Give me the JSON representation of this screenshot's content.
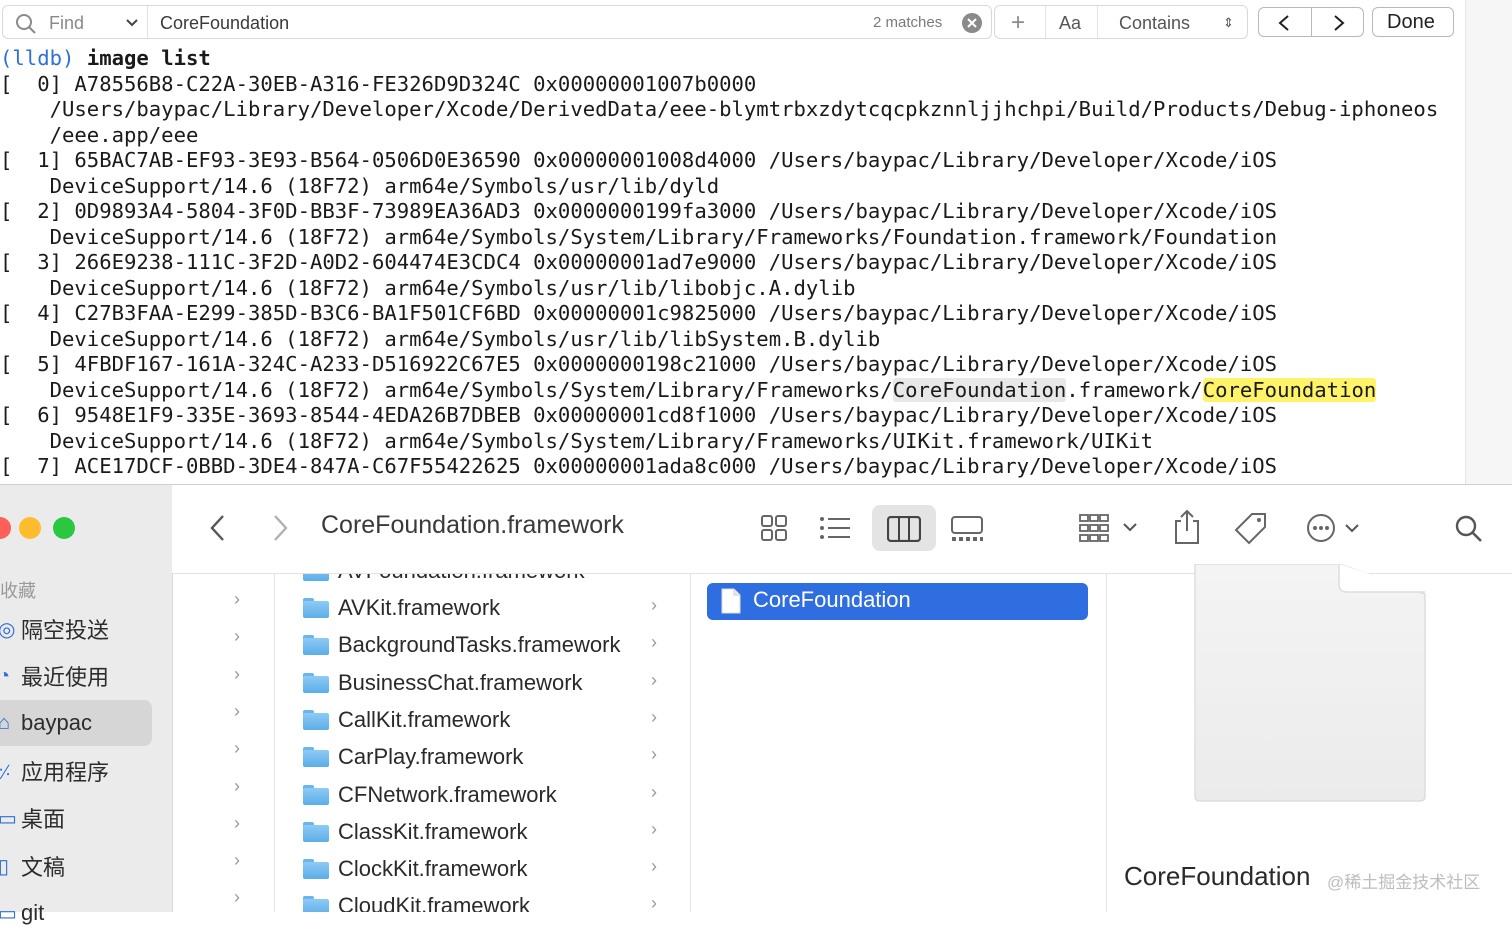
{
  "find_bar": {
    "find_label": "Find",
    "query": "CoreFoundation",
    "matches": "2 matches",
    "case_button": "Aa",
    "mode": "Contains",
    "done_label": "Done"
  },
  "console": {
    "prompt": "(lldb)",
    "command": "image list",
    "lines": [
      "[  0] A78556B8-C22A-30EB-A316-FE326D9D324C 0x00000001007b0000",
      "    /Users/baypac/Library/Developer/Xcode/DerivedData/eee-blymtrbxzdytcqcpkznnljjhchpi/Build/Products/Debug-iphoneos",
      "    /eee.app/eee",
      "[  1] 65BAC7AB-EF93-3E93-B564-0506D0E36590 0x00000001008d4000 /Users/baypac/Library/Developer/Xcode/iOS",
      "    DeviceSupport/14.6 (18F72) arm64e/Symbols/usr/lib/dyld",
      "[  2] 0D9893A4-5804-3F0D-BB3F-73989EA36AD3 0x0000000199fa3000 /Users/baypac/Library/Developer/Xcode/iOS",
      "    DeviceSupport/14.6 (18F72) arm64e/Symbols/System/Library/Frameworks/Foundation.framework/Foundation",
      "[  3] 266E9238-111C-3F2D-A0D2-604474E3CDC4 0x00000001ad7e9000 /Users/baypac/Library/Developer/Xcode/iOS",
      "    DeviceSupport/14.6 (18F72) arm64e/Symbols/usr/lib/libobjc.A.dylib",
      "[  4] C27B3FAA-E299-385D-B3C6-BA1F501CF6BD 0x00000001c9825000 /Users/baypac/Library/Developer/Xcode/iOS",
      "    DeviceSupport/14.6 (18F72) arm64e/Symbols/usr/lib/libSystem.B.dylib",
      "[  5] 4FBDF167-161A-324C-A233-D516922C67E5 0x0000000198c21000 /Users/baypac/Library/Developer/Xcode/iOS",
      "",
      "[  6] 9548E1F9-335E-3693-8544-4EDA26B7DBEB 0x00000001cd8f1000 /Users/baypac/Library/Developer/Xcode/iOS",
      "    DeviceSupport/14.6 (18F72) arm64e/Symbols/System/Library/Frameworks/UIKit.framework/UIKit",
      "[  7] ACE17DCF-0BBD-3DE4-847A-C67F55422625 0x00000001ada8c000 /Users/baypac/Library/Developer/Xcode/iOS"
    ],
    "highlight_line": {
      "prefix": "    DeviceSupport/14.6 (18F72) arm64e/Symbols/System/Library/Frameworks/",
      "match1": "CoreFoundation",
      "middle": ".framework/",
      "match2": "CoreFoundation"
    }
  },
  "finder": {
    "title": "CoreFoundation.framework",
    "sidebar": {
      "section": "收藏",
      "items": [
        {
          "label": "隔空投送",
          "icon": "airdrop-icon"
        },
        {
          "label": "最近使用",
          "icon": "clock-icon"
        },
        {
          "label": "baypac",
          "icon": "home-icon",
          "selected": true
        },
        {
          "label": "应用程序",
          "icon": "applications-icon"
        },
        {
          "label": "桌面",
          "icon": "desktop-icon"
        },
        {
          "label": "文稿",
          "icon": "document-icon"
        },
        {
          "label": "git",
          "icon": "folder-icon"
        }
      ]
    },
    "list_partial": "AVFoundation.framework",
    "list": [
      "AVKit.framework",
      "BackgroundTasks.framework",
      "BusinessChat.framework",
      "CallKit.framework",
      "CarPlay.framework",
      "CFNetwork.framework",
      "ClassKit.framework",
      "ClockKit.framework",
      "CloudKit.framework"
    ],
    "selected_file": "CoreFoundation",
    "preview_name": "CoreFoundation",
    "accent": "#2f6ee0"
  },
  "watermark": "@稀土掘金技术社区"
}
